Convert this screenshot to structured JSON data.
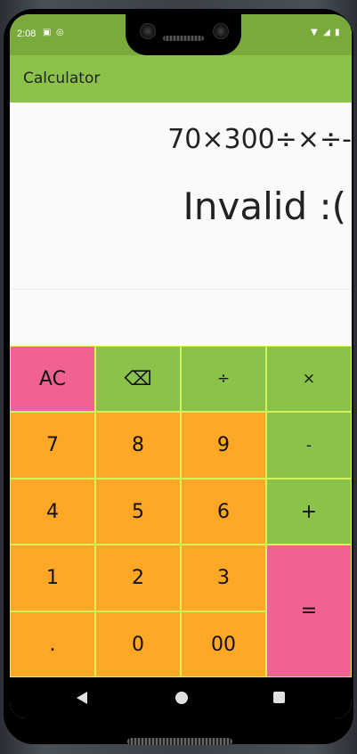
{
  "status_bar": {
    "time": "2:08",
    "icons": [
      "a-notification-icon",
      "sync-icon",
      "wifi-icon",
      "signal-icon",
      "battery-icon"
    ]
  },
  "app_bar": {
    "title": "Calculator"
  },
  "display": {
    "expression": "70×300÷×÷-",
    "result": "Invalid :("
  },
  "keypad": {
    "row1": [
      "AC",
      "⌫",
      "÷",
      "×"
    ],
    "row2": [
      "7",
      "8",
      "9",
      "-"
    ],
    "row3": [
      "4",
      "5",
      "6",
      "+"
    ],
    "row4": [
      "1",
      "2",
      "3"
    ],
    "row5": [
      ".",
      "0",
      "00"
    ],
    "equals": "="
  },
  "colors": {
    "number_key": "#ffa726",
    "operator_key": "#8bc34a",
    "accent_key": "#f06292",
    "key_border": "#d4f15a",
    "app_bar": "#8bc34a",
    "status_bar": "#7aaa3c"
  }
}
